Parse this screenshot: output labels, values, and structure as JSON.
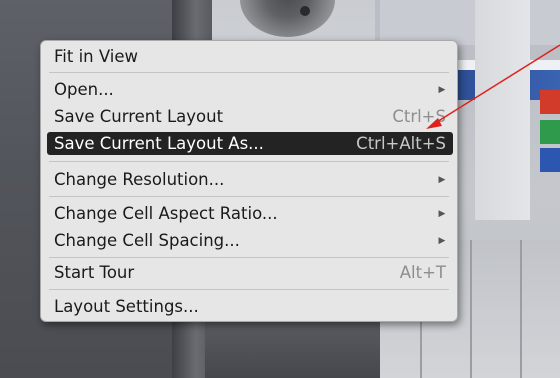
{
  "context_menu": {
    "items": [
      {
        "label": "Fit in View",
        "shortcut": "",
        "submenu": false
      },
      {
        "label": "Open...",
        "shortcut": "",
        "submenu": true
      },
      {
        "label": "Save Current Layout",
        "shortcut": "Ctrl+S",
        "submenu": false
      },
      {
        "label": "Save Current Layout As...",
        "shortcut": "Ctrl+Alt+S",
        "submenu": false,
        "highlighted": true
      },
      {
        "label": "Change Resolution...",
        "shortcut": "",
        "submenu": true
      },
      {
        "label": "Change Cell Aspect Ratio...",
        "shortcut": "",
        "submenu": true
      },
      {
        "label": "Change Cell Spacing...",
        "shortcut": "",
        "submenu": true
      },
      {
        "label": "Start Tour",
        "shortcut": "Alt+T",
        "submenu": false
      },
      {
        "label": "Layout Settings...",
        "shortcut": "",
        "submenu": false
      }
    ],
    "submenu_icon": "triangle-right-icon"
  },
  "colors": {
    "menu_background": "#e6e6e6",
    "highlight_background": "#232323",
    "annotation_arrow": "#e0201c"
  }
}
